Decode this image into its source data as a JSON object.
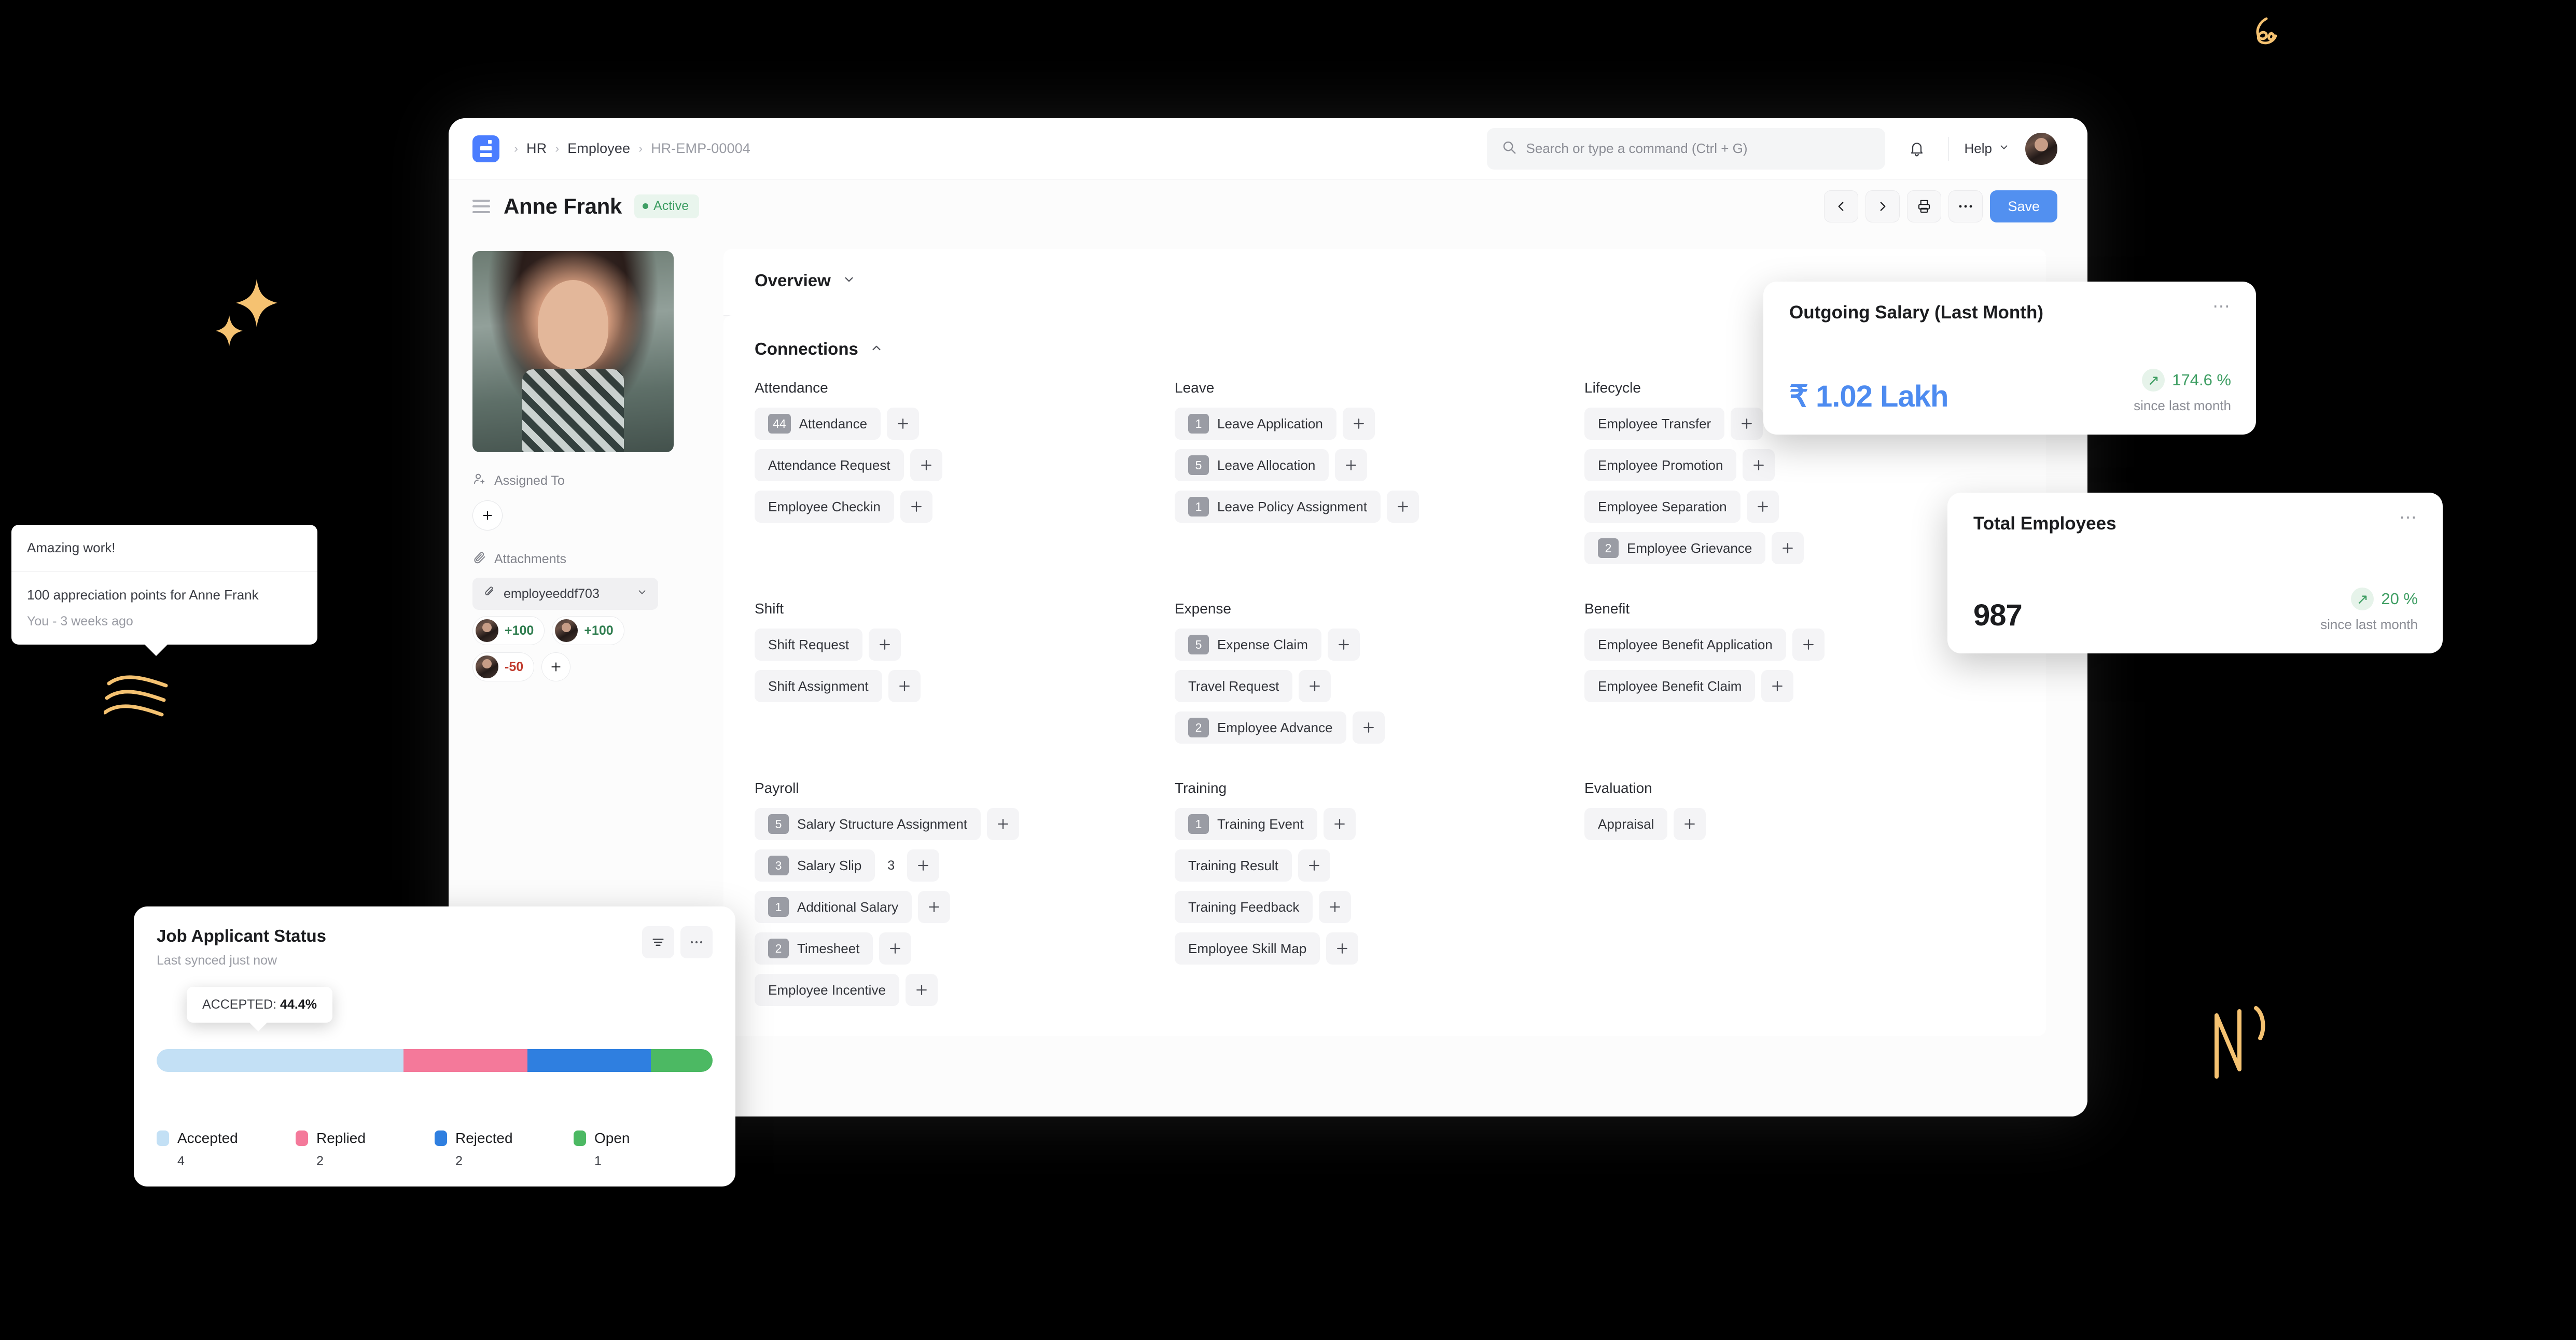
{
  "navbar": {
    "logo_icon": "frappe-logo-icon",
    "breadcrumb": [
      {
        "label": "HR",
        "muted": false
      },
      {
        "label": "Employee",
        "muted": false
      },
      {
        "label": "HR-EMP-00004",
        "muted": true
      }
    ],
    "search": {
      "placeholder": "Search or type a command (Ctrl + G)",
      "icon": "search-icon"
    },
    "notification_icon": "bell-icon",
    "help_label": "Help",
    "help_chevron": "chevron-down-icon",
    "avatar_icon": "user-avatar"
  },
  "page_head": {
    "menu_icon": "hamburger-icon",
    "title": "Anne Frank",
    "status": "Active",
    "status_color": "#3e9e63",
    "actions": {
      "prev_icon": "chevron-left-icon",
      "next_icon": "chevron-right-icon",
      "print_icon": "printer-icon",
      "more_icon": "ellipsis-icon",
      "save_label": "Save",
      "save_color": "#5290f0"
    }
  },
  "sidebar": {
    "photo_alt": "employee-photo",
    "assigned_to_label": "Assigned To",
    "assigned_to_icon": "user-plus-icon",
    "assign_add_icon": "plus-icon",
    "attachments_label": "Attachments",
    "attachments_icon": "paperclip-icon",
    "attachment_file": "employeeddf703",
    "attachment_chevron": "chevron-down-icon",
    "points": [
      {
        "value": "+100",
        "sign": "pos"
      },
      {
        "value": "+100",
        "sign": "pos"
      },
      {
        "value": "-50",
        "sign": "neg"
      }
    ],
    "points_add_icon": "plus-icon"
  },
  "comment_popover": {
    "comment": "Amazing work!",
    "points_text": "100 appreciation points for Anne Frank",
    "author": "You - ",
    "time": "3 weeks ago"
  },
  "sections": {
    "overview_title": "Overview",
    "overview_chevron": "chevron-down-icon",
    "connections_title": "Connections",
    "connections_chevron": "chevron-up-icon"
  },
  "connections": [
    {
      "group": "Attendance",
      "items": [
        {
          "count": "44",
          "label": "Attendance"
        },
        {
          "count": "",
          "label": "Attendance Request"
        },
        {
          "count": "",
          "label": "Employee Checkin"
        }
      ]
    },
    {
      "group": "Leave",
      "items": [
        {
          "count": "1",
          "label": "Leave Application"
        },
        {
          "count": "5",
          "label": "Leave Allocation"
        },
        {
          "count": "1",
          "label": "Leave Policy Assignment"
        }
      ]
    },
    {
      "group": "Lifecycle",
      "items": [
        {
          "count": "",
          "label": "Employee Transfer"
        },
        {
          "count": "",
          "label": "Employee Promotion"
        },
        {
          "count": "",
          "label": "Employee Separation"
        },
        {
          "count": "2",
          "label": "Employee Grievance"
        }
      ]
    },
    {
      "group": "Shift",
      "items": [
        {
          "count": "",
          "label": "Shift Request"
        },
        {
          "count": "",
          "label": "Shift Assignment"
        }
      ]
    },
    {
      "group": "Expense",
      "items": [
        {
          "count": "5",
          "label": "Expense Claim"
        },
        {
          "count": "",
          "label": "Travel Request"
        },
        {
          "count": "2",
          "label": "Employee Advance"
        }
      ]
    },
    {
      "group": "Benefit",
      "items": [
        {
          "count": "",
          "label": "Employee Benefit Application"
        },
        {
          "count": "",
          "label": "Employee Benefit Claim"
        }
      ]
    },
    {
      "group": "Payroll",
      "items": [
        {
          "count": "5",
          "label": "Salary Structure Assignment"
        },
        {
          "count": "3",
          "label": "Salary Slip",
          "extra": "3"
        },
        {
          "count": "1",
          "label": "Additional Salary"
        },
        {
          "count": "2",
          "label": "Timesheet"
        },
        {
          "count": "",
          "label": "Employee Incentive"
        }
      ]
    },
    {
      "group": "Training",
      "items": [
        {
          "count": "1",
          "label": "Training Event"
        },
        {
          "count": "",
          "label": "Training Result"
        },
        {
          "count": "",
          "label": "Training Feedback"
        },
        {
          "count": "",
          "label": "Employee Skill Map"
        }
      ]
    },
    {
      "group": "Evaluation",
      "items": [
        {
          "count": "",
          "label": "Appraisal"
        }
      ]
    }
  ],
  "number_cards": [
    {
      "title": "Outgoing Salary (Last Month)",
      "value": "₹ 1.02 Lakh",
      "value_color": "#4d8bf0",
      "delta": "174.6 %",
      "delta_icon": "arrow-up-right-icon",
      "delta_sub": "since last month",
      "menu_icon": "ellipsis-icon"
    },
    {
      "title": "Total Employees",
      "value": "987",
      "value_color": "#1b1c1f",
      "delta": "20 %",
      "delta_icon": "arrow-up-right-icon",
      "delta_sub": "since last month",
      "menu_icon": "ellipsis-icon"
    }
  ],
  "chart_card": {
    "title": "Job Applicant Status",
    "subtitle": "Last synced just now",
    "filter_icon": "filter-icon",
    "menu_icon": "ellipsis-icon",
    "tooltip_label": "ACCEPTED:",
    "tooltip_value": "44.4%"
  },
  "chart_data": {
    "type": "bar",
    "title": "Job Applicant Status",
    "subtitle": "Last synced just now",
    "orientation": "horizontal-stacked",
    "categories": [
      "Accepted",
      "Replied",
      "Rejected",
      "Open"
    ],
    "values": [
      4,
      2,
      2,
      1
    ],
    "percentages": [
      44.4,
      22.2,
      22.2,
      11.1
    ],
    "colors": [
      "#c3e0f5",
      "#f4799a",
      "#2f7fe0",
      "#4cb963"
    ],
    "total": 9,
    "legend_position": "bottom",
    "grid": false,
    "annotation": "ACCEPTED: 44.4%"
  }
}
